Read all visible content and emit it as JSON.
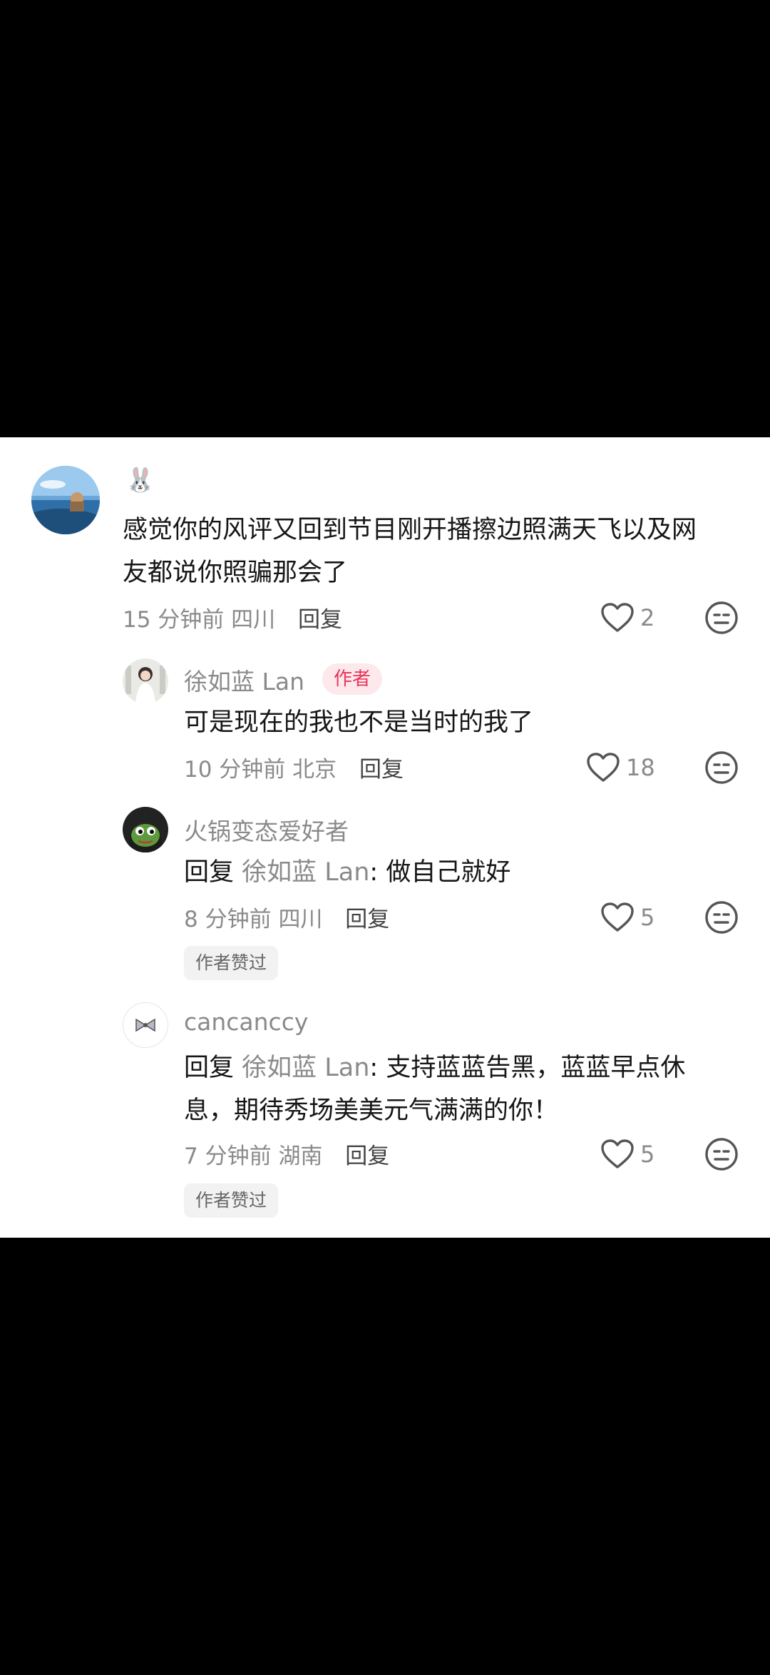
{
  "comments": [
    {
      "avatar_icon": "beach-photo-avatar",
      "username": "🐰",
      "text_lines": [
        "感觉你的风评又回到节目刚开播擦边照满天飞以及网",
        "友都说你照骗那会了"
      ],
      "time": "15 分钟前",
      "location": "四川",
      "reply_label": "回复",
      "likes": "2"
    },
    {
      "avatar_icon": "woman-photo-avatar",
      "username": "徐如蓝 Lan",
      "badge": "作者",
      "text": "可是现在的我也不是当时的我了",
      "time": "10 分钟前",
      "location": "北京",
      "reply_label": "回复",
      "likes": "18"
    },
    {
      "avatar_icon": "frog-avatar",
      "username": "火锅变态爱好者",
      "reply_prefix": "回复",
      "mention": "徐如蓝 Lan",
      "text": ": 做自己就好",
      "time": "8 分钟前",
      "location": "四川",
      "reply_label": "回复",
      "likes": "5",
      "chip": "作者赞过"
    },
    {
      "avatar_icon": "bow-avatar",
      "username": "cancanccy",
      "reply_prefix": "回复",
      "mention": "徐如蓝 Lan",
      "text": ": 支持蓝蓝告黑，蓝蓝早点休",
      "text_line2": "息，期待秀场美美元气满满的你！",
      "time": "7 分钟前",
      "location": "湖南",
      "reply_label": "回复",
      "likes": "5",
      "chip": "作者赞过"
    }
  ],
  "colors": {
    "background": "#000000",
    "panel": "#ffffff",
    "badge_bg": "#fde8ec",
    "badge_text": "#e8355a",
    "secondary_text": "#8a8a8a"
  }
}
